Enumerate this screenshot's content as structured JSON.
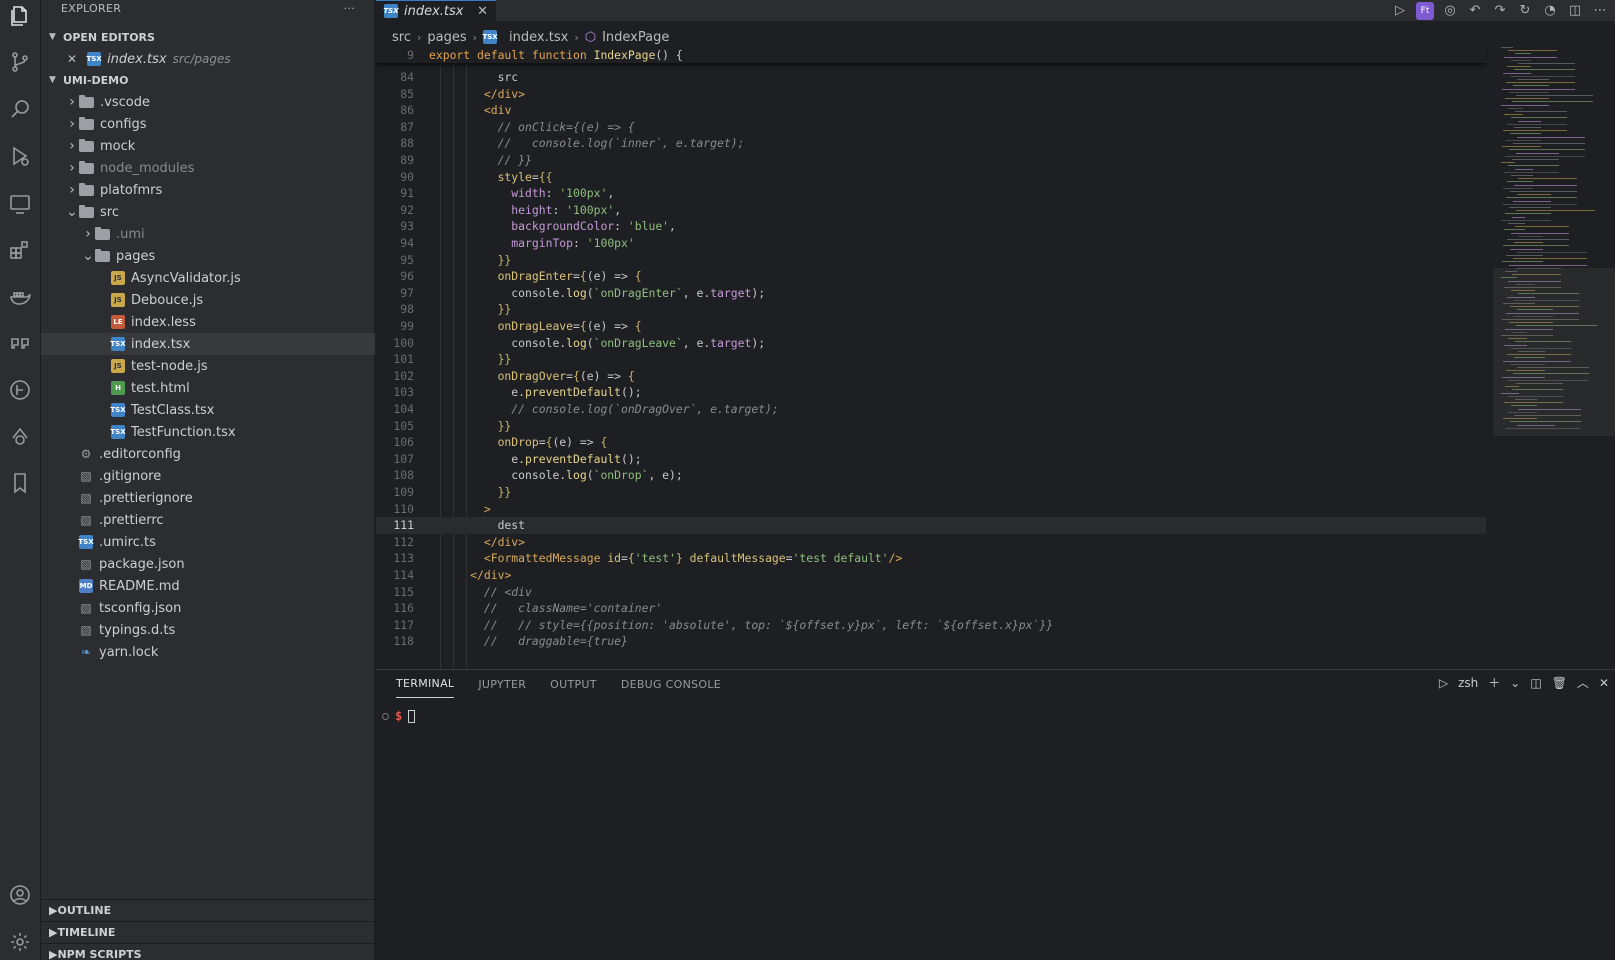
{
  "explorer": {
    "title": "EXPLORER",
    "more": "···",
    "open_editors": {
      "label": "OPEN EDITORS",
      "items": [
        {
          "name": "index.tsx",
          "path": "src/pages"
        }
      ]
    },
    "project": "UMI-DEMO",
    "tree": [
      {
        "type": "folder",
        "name": ".vscode",
        "depth": 1,
        "open": false
      },
      {
        "type": "folder",
        "name": "configs",
        "depth": 1,
        "open": false
      },
      {
        "type": "folder",
        "name": "mock",
        "depth": 1,
        "open": false
      },
      {
        "type": "folder",
        "name": "node_modules",
        "depth": 1,
        "open": false,
        "dim": true
      },
      {
        "type": "folder",
        "name": "platofmrs",
        "depth": 1,
        "open": false
      },
      {
        "type": "folder",
        "name": "src",
        "depth": 1,
        "open": true
      },
      {
        "type": "folder",
        "name": ".umi",
        "depth": 2,
        "open": false,
        "dim": true
      },
      {
        "type": "folder",
        "name": "pages",
        "depth": 2,
        "open": true
      },
      {
        "type": "file",
        "name": "AsyncValidator.js",
        "depth": 3,
        "icon": "js"
      },
      {
        "type": "file",
        "name": "Debouce.js",
        "depth": 3,
        "icon": "js"
      },
      {
        "type": "file",
        "name": "index.less",
        "depth": 3,
        "icon": "less"
      },
      {
        "type": "file",
        "name": "index.tsx",
        "depth": 3,
        "icon": "tsx",
        "selected": true
      },
      {
        "type": "file",
        "name": "test-node.js",
        "depth": 3,
        "icon": "js"
      },
      {
        "type": "file",
        "name": "test.html",
        "depth": 3,
        "icon": "html"
      },
      {
        "type": "file",
        "name": "TestClass.tsx",
        "depth": 3,
        "icon": "tsx"
      },
      {
        "type": "file",
        "name": "TestFunction.tsx",
        "depth": 3,
        "icon": "tsx"
      },
      {
        "type": "file",
        "name": ".editorconfig",
        "depth": 1,
        "icon": "gear"
      },
      {
        "type": "file",
        "name": ".gitignore",
        "depth": 1,
        "icon": "cfg"
      },
      {
        "type": "file",
        "name": ".prettierignore",
        "depth": 1,
        "icon": "cfg"
      },
      {
        "type": "file",
        "name": ".prettierrc",
        "depth": 1,
        "icon": "cfg"
      },
      {
        "type": "file",
        "name": ".umirc.ts",
        "depth": 1,
        "icon": "tsx"
      },
      {
        "type": "file",
        "name": "package.json",
        "depth": 1,
        "icon": "cfg"
      },
      {
        "type": "file",
        "name": "README.md",
        "depth": 1,
        "icon": "md"
      },
      {
        "type": "file",
        "name": "tsconfig.json",
        "depth": 1,
        "icon": "cfg"
      },
      {
        "type": "file",
        "name": "typings.d.ts",
        "depth": 1,
        "icon": "cfg"
      },
      {
        "type": "file",
        "name": "yarn.lock",
        "depth": 1,
        "icon": "yarn"
      }
    ],
    "bottom_sections": [
      "OUTLINE",
      "TIMELINE",
      "NPM SCRIPTS"
    ]
  },
  "tab": {
    "label": "index.tsx",
    "close": "✕"
  },
  "toolbar_badge": "Ft",
  "breadcrumb": [
    "src",
    "pages",
    "index.tsx",
    "IndexPage"
  ],
  "editor": {
    "sticky": {
      "num": "9",
      "html": "<span class='kw'>export default function</span> <span class='fn'>IndexPage</span>() {"
    },
    "current_line": "111",
    "lines": [
      {
        "num": "84",
        "html": "          src"
      },
      {
        "num": "85",
        "html": "        <span class='tag'>&lt;/div&gt;</span>"
      },
      {
        "num": "86",
        "html": "        <span class='tag'>&lt;div</span>"
      },
      {
        "num": "87",
        "html": "          <span class='com'>// onClick={(e) =&gt; {</span>"
      },
      {
        "num": "88",
        "html": "          <span class='com'>//   console.log(`inner`, e.target);</span>"
      },
      {
        "num": "89",
        "html": "          <span class='com'>// }}</span>"
      },
      {
        "num": "90",
        "html": "          <span class='attr'>style</span>=<span class='br'>{{</span>"
      },
      {
        "num": "91",
        "html": "            <span class='prop'>width</span>: <span class='str'>'100px'</span>,"
      },
      {
        "num": "92",
        "html": "            <span class='prop'>height</span>: <span class='str'>'100px'</span>,"
      },
      {
        "num": "93",
        "html": "            <span class='prop'>backgroundColor</span>: <span class='str'>'blue'</span>,"
      },
      {
        "num": "94",
        "html": "            <span class='prop'>marginTop</span>: <span class='str'>'100px'</span>"
      },
      {
        "num": "95",
        "html": "          <span class='br'>}}</span>"
      },
      {
        "num": "96",
        "html": "          <span class='attr'>onDragEnter</span>=<span class='br'>{</span>(e) =&gt; <span class='br'>{</span>"
      },
      {
        "num": "97",
        "html": "            console.<span class='fn'>log</span>(<span class='str'>`onDragEnter`</span>, e.<span class='prop'>target</span>);"
      },
      {
        "num": "98",
        "html": "          <span class='br'>}}</span>"
      },
      {
        "num": "99",
        "html": "          <span class='attr'>onDragLeave</span>=<span class='br'>{</span>(e) =&gt; <span class='br'>{</span>"
      },
      {
        "num": "100",
        "html": "            console.<span class='fn'>log</span>(<span class='str'>`onDragLeave`</span>, e.<span class='prop'>target</span>);"
      },
      {
        "num": "101",
        "html": "          <span class='br'>}}</span>"
      },
      {
        "num": "102",
        "html": "          <span class='attr'>onDragOver</span>=<span class='br'>{</span>(e) =&gt; <span class='br'>{</span>"
      },
      {
        "num": "103",
        "html": "            e.<span class='fn'>preventDefault</span>();"
      },
      {
        "num": "104",
        "html": "            <span class='com'>// console.log(`onDragOver`, e.target);</span>"
      },
      {
        "num": "105",
        "html": "          <span class='br'>}}</span>"
      },
      {
        "num": "106",
        "html": "          <span class='attr'>onDrop</span>=<span class='br'>{</span>(e) =&gt; <span class='br'>{</span>"
      },
      {
        "num": "107",
        "html": "            e.<span class='fn'>preventDefault</span>();"
      },
      {
        "num": "108",
        "html": "            console.<span class='fn'>log</span>(<span class='str'>`onDrop`</span>, e);"
      },
      {
        "num": "109",
        "html": "          <span class='br'>}}</span>"
      },
      {
        "num": "110",
        "html": "        <span class='tag'>&gt;</span>"
      },
      {
        "num": "111",
        "html": "          dest"
      },
      {
        "num": "112",
        "html": "        <span class='tag'>&lt;/div&gt;</span>"
      },
      {
        "num": "113",
        "html": "        <span class='tag'>&lt;FormattedMessage</span> <span class='attr'>id</span>=<span class='br'>{</span><span class='str'>'test'</span><span class='br'>}</span> <span class='attr'>defaultMessage</span>=<span class='str'>'test default'</span><span class='tag'>/&gt;</span>"
      },
      {
        "num": "114",
        "html": "      <span class='tag'>&lt;/div&gt;</span>"
      },
      {
        "num": "115",
        "html": "        <span class='com'>// &lt;div</span>"
      },
      {
        "num": "116",
        "html": "        <span class='com'>//   className='container'</span>"
      },
      {
        "num": "117",
        "html": "        <span class='com'>//   // style={{position: 'absolute', top: `${offset.y}px`, left: `${offset.x}px`}}</span>"
      },
      {
        "num": "118",
        "html": "        <span class='com'>//   draggable={true}</span>"
      }
    ]
  },
  "panel": {
    "tabs": [
      "TERMINAL",
      "JUPYTER",
      "OUTPUT",
      "DEBUG CONSOLE"
    ],
    "active_tab": "TERMINAL",
    "shell": "zsh",
    "prompt": "$"
  }
}
